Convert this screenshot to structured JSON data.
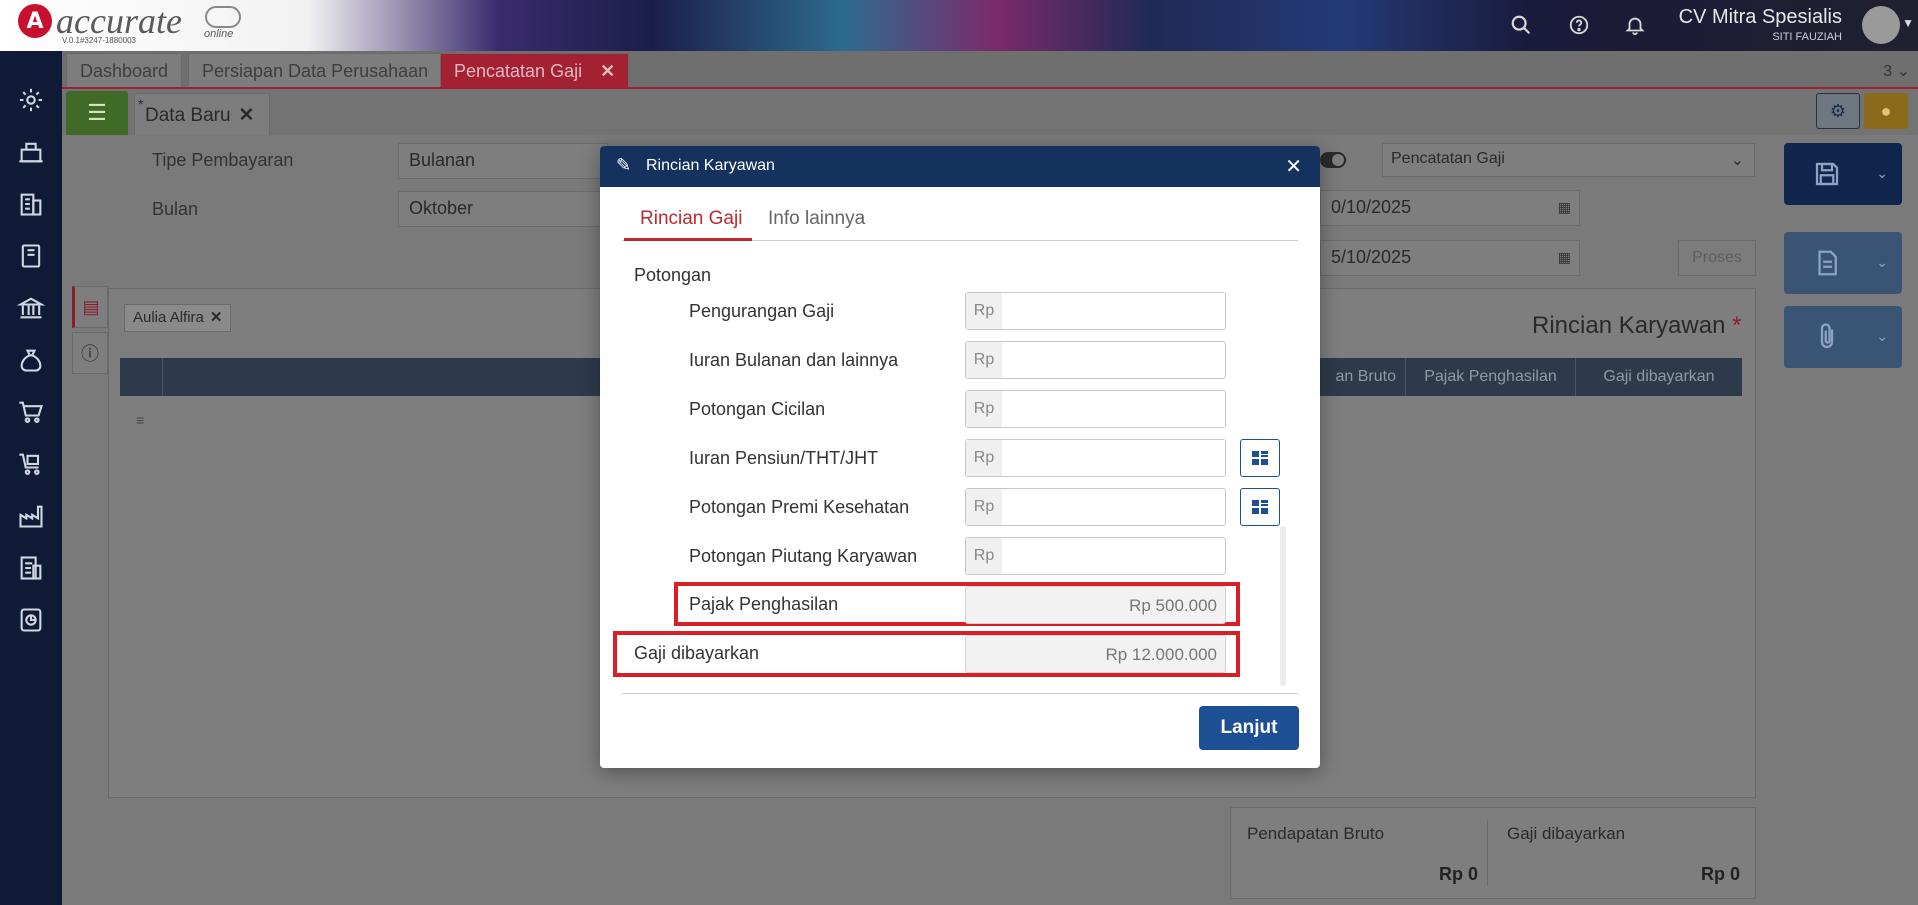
{
  "header": {
    "brand": "accurate",
    "brand_sub": "online",
    "version": "V.0.1#3247-1880003",
    "company_name": "CV Mitra Spesialis",
    "user_name": "SITI FAUZIAH"
  },
  "tabs": {
    "items": [
      {
        "label": "Dashboard"
      },
      {
        "label": "Persiapan Data Perusahaan"
      },
      {
        "label": "Pencatatan Gaji"
      }
    ],
    "count": "3"
  },
  "subtab": {
    "star": "*",
    "label": "Data Baru"
  },
  "form": {
    "tipe_label": "Tipe Pembayaran",
    "tipe_value": "Bulanan",
    "bulan_label": "Bulan",
    "bulan_value": "Oktober",
    "type_select": "Pencatatan Gaji",
    "date1": "0/10/2025",
    "date2": "5/10/2025",
    "proses": "Proses"
  },
  "panel": {
    "chip": "Aulia Alfira",
    "title": "Rincian Karyawan",
    "required_mark": "*",
    "columns": [
      "an Bruto",
      "Pajak Penghasilan",
      "Gaji dibayarkan"
    ]
  },
  "totals": {
    "bruto_label": "Pendapatan Bruto",
    "bruto_value": "Rp 0",
    "gaji_label": "Gaji dibayarkan",
    "gaji_value": "Rp 0"
  },
  "modal": {
    "title": "Rincian Karyawan",
    "tabs": [
      "Rincian Gaji",
      "Info lainnya"
    ],
    "section": "Potongan",
    "currency_prefix": "Rp",
    "rows": [
      {
        "label": "Pengurangan Gaji"
      },
      {
        "label": "Iuran Bulanan dan lainnya"
      },
      {
        "label": "Potongan Cicilan"
      },
      {
        "label": "Iuran Pensiun/THT/JHT"
      },
      {
        "label": "Potongan Premi Kesehatan"
      },
      {
        "label": "Potongan Piutang Karyawan"
      }
    ],
    "pajak_label": "Pajak Penghasilan",
    "pajak_value": "Rp 500.000",
    "gaji_label": "Gaji dibayarkan",
    "gaji_value": "Rp 12.000.000",
    "next_button": "Lanjut"
  },
  "colors": {
    "brand_red": "#c8102e",
    "navy": "#15325e",
    "primary_button": "#1d4f94",
    "highlight": "#d81f26",
    "active_tab": "#c0282d"
  }
}
